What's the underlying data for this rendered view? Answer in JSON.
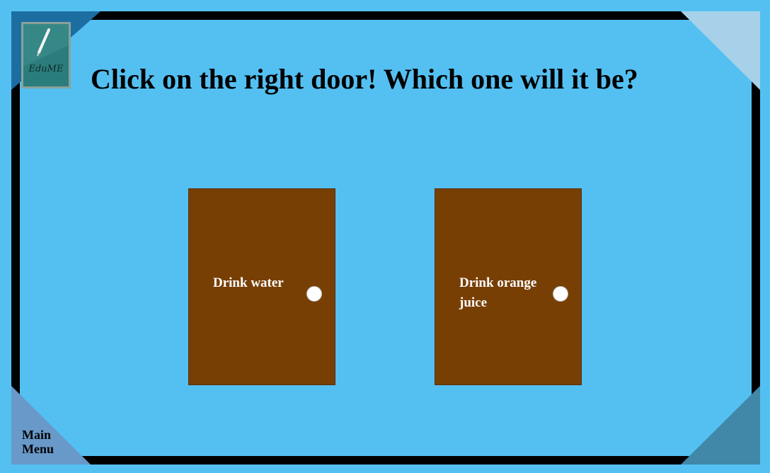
{
  "header": {
    "title": "Click on the right door! Which one will it be?",
    "logo_text": "EduME"
  },
  "doors": [
    {
      "label": "Drink water"
    },
    {
      "label": "Drink orange juice"
    }
  ],
  "nav": {
    "main_menu_line1": "Main",
    "main_menu_line2": "Menu"
  },
  "colors": {
    "background": "#54c0f2",
    "frame": "#000000",
    "door": "#783f04",
    "knob": "#ffffff",
    "corner_top_left": "#1c6ea1",
    "corner_top_right": "#a6d1e8",
    "corner_bottom_left": "#6899c9",
    "corner_bottom_right": "#4187a8"
  },
  "icons": {
    "logo": "pen-slate-logo-icon",
    "door_knob": "door-knob-icon"
  }
}
